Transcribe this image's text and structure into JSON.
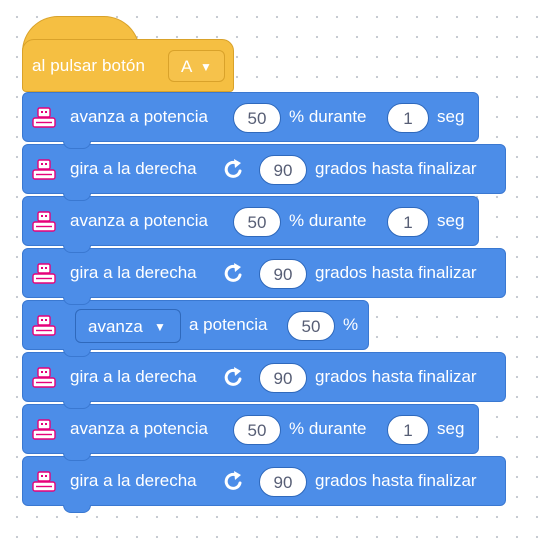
{
  "event": {
    "label": "al pulsar botón",
    "button": "A"
  },
  "blocks": [
    {
      "kind": "move_for",
      "text1": "avanza a potencia",
      "power": "50",
      "text2": "% durante",
      "duration": "1",
      "unit": "seg"
    },
    {
      "kind": "turn",
      "text1": "gira a la derecha",
      "degrees": "90",
      "text2": "grados hasta finalizar"
    },
    {
      "kind": "move_for",
      "text1": "avanza a potencia",
      "power": "50",
      "text2": "% durante",
      "duration": "1",
      "unit": "seg"
    },
    {
      "kind": "turn",
      "text1": "gira a la derecha",
      "degrees": "90",
      "text2": "grados hasta finalizar"
    },
    {
      "kind": "move",
      "direction": "avanza",
      "text1": "a potencia",
      "power": "50",
      "unit": "%"
    },
    {
      "kind": "turn",
      "text1": "gira a la derecha",
      "degrees": "90",
      "text2": "grados hasta finalizar"
    },
    {
      "kind": "move_for",
      "text1": "avanza a potencia",
      "power": "50",
      "text2": "% durante",
      "duration": "1",
      "unit": "seg"
    },
    {
      "kind": "turn",
      "text1": "gira a la derecha",
      "degrees": "90",
      "text2": "grados hasta finalizar"
    }
  ],
  "colors": {
    "event": "#f5bf42",
    "motion": "#4c8de8",
    "icon_accent": "#e6007a"
  },
  "icons": {
    "block": "robot-icon",
    "turn": "rotate-clockwise-icon",
    "dropdown": "triangle-down-icon"
  }
}
